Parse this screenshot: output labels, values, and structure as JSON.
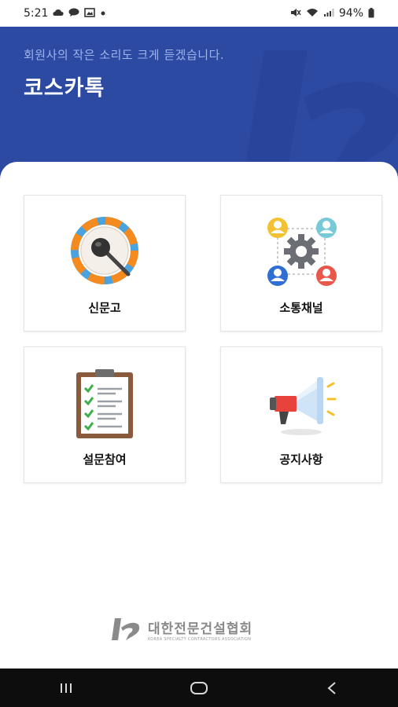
{
  "status_bar": {
    "time": "5:21",
    "battery": "94%",
    "left_icons": [
      "cloud-icon",
      "chat-icon",
      "gallery-icon",
      "dot-icon"
    ],
    "right_icons": [
      "mute-icon",
      "wifi-icon",
      "signal-icon",
      "battery-icon"
    ]
  },
  "header": {
    "subtitle": "회원사의 작은 소리도 크게 듣겠습니다.",
    "title": "코스카톡",
    "accent_color": "#2d4aa3"
  },
  "menu": {
    "items": [
      {
        "label": "신문고",
        "icon": "gong-icon"
      },
      {
        "label": "소통채널",
        "icon": "network-gear-icon"
      },
      {
        "label": "설문참여",
        "icon": "clipboard-icon"
      },
      {
        "label": "공지사항",
        "icon": "megaphone-icon"
      }
    ]
  },
  "footer": {
    "org_name": "대한전문건설협회",
    "org_name_en": "KOREA SPECIALTY CONTRACTORS ASSOCIATION"
  },
  "nav_bar": {
    "buttons": [
      "recent-apps-icon",
      "home-icon",
      "back-icon"
    ]
  }
}
